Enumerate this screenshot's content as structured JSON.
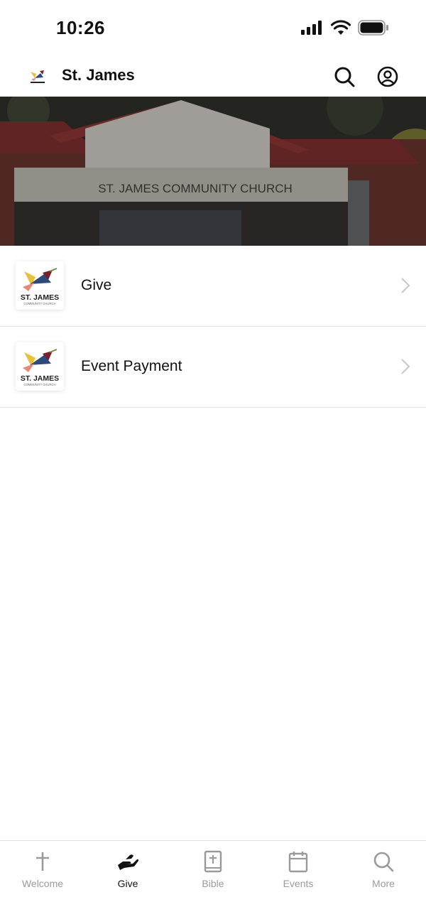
{
  "status_bar": {
    "time": "10:26"
  },
  "header": {
    "title": "St. James",
    "logo_icon": "bird-logo-icon",
    "search_icon": "search-icon",
    "account_icon": "account-icon"
  },
  "banner": {
    "sign_text": "ST. JAMES COMMUNITY CHURCH"
  },
  "thumb": {
    "name": "ST. JAMES",
    "sub": "COMMUNITY CHURCH"
  },
  "list": [
    {
      "label": "Give",
      "icon": "chevron-right-icon"
    },
    {
      "label": "Event Payment",
      "icon": "chevron-right-icon"
    }
  ],
  "tabs": [
    {
      "label": "Welcome",
      "icon": "cross-icon",
      "active": false
    },
    {
      "label": "Give",
      "icon": "give-hand-icon",
      "active": true
    },
    {
      "label": "Bible",
      "icon": "bible-icon",
      "active": false
    },
    {
      "label": "Events",
      "icon": "calendar-icon",
      "active": false
    },
    {
      "label": "More",
      "icon": "search-icon",
      "active": false
    }
  ],
  "colors": {
    "accent": "#111111",
    "inactive": "#9a9a9a",
    "divider": "#e3e3e3"
  }
}
